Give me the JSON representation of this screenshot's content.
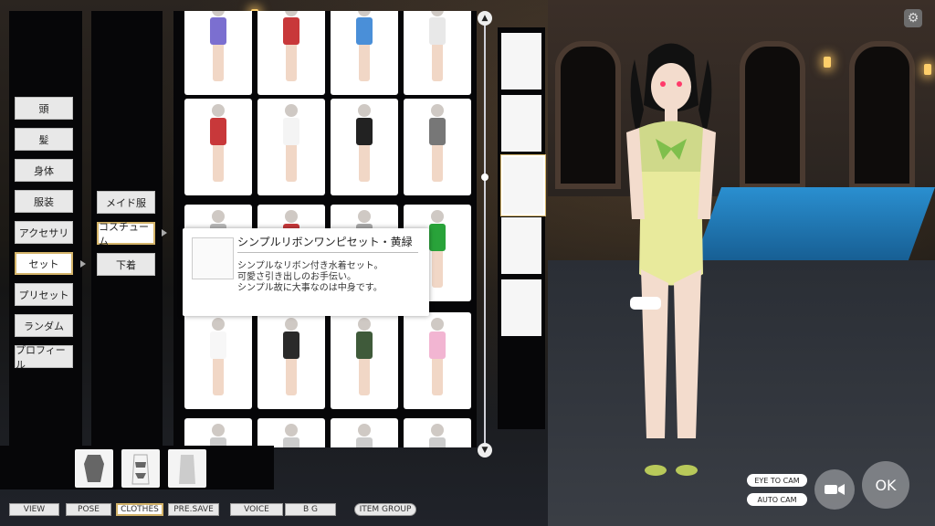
{
  "left_menu": [
    {
      "label": "頭",
      "active": false
    },
    {
      "label": "髪",
      "active": false
    },
    {
      "label": "身体",
      "active": false
    },
    {
      "label": "服装",
      "active": false
    },
    {
      "label": "アクセサリ",
      "active": false
    },
    {
      "label": "セット",
      "active": true
    },
    {
      "label": "プリセット",
      "active": false
    },
    {
      "label": "ランダム",
      "active": false
    },
    {
      "label": "プロフィール",
      "active": false
    }
  ],
  "sub_menu": [
    {
      "label": "メイド服",
      "active": false
    },
    {
      "label": "コスチューム",
      "active": true
    },
    {
      "label": "下着",
      "active": false
    }
  ],
  "tooltip": {
    "title": "シンプルリボンワンピセット・黄緑",
    "lines": [
      "シンプルなリボン付き水着セット。",
      "可愛さ引き出しのお手伝い。",
      "シンプル故に大事なのは中身です。"
    ]
  },
  "bottom_tabs": [
    {
      "label": "VIEW",
      "active": false
    },
    {
      "label": "POSE",
      "active": false
    },
    {
      "label": "CLOTHES",
      "active": true
    },
    {
      "label": "PRE.SAVE",
      "active": false
    },
    {
      "label": "VOICE",
      "active": false
    },
    {
      "label": "B G",
      "active": false
    },
    {
      "label": "ITEM GROUP",
      "active": false
    }
  ],
  "camera": {
    "eye_to_cam": "EYE TO CAM",
    "auto_cam": "AUTO CAM"
  },
  "ok_label": "OK",
  "icons": {
    "gear": "⚙",
    "scroll_up": "▲",
    "scroll_down": "▼",
    "camera": "📹"
  },
  "colors": {
    "accent": "#d4b46a"
  }
}
